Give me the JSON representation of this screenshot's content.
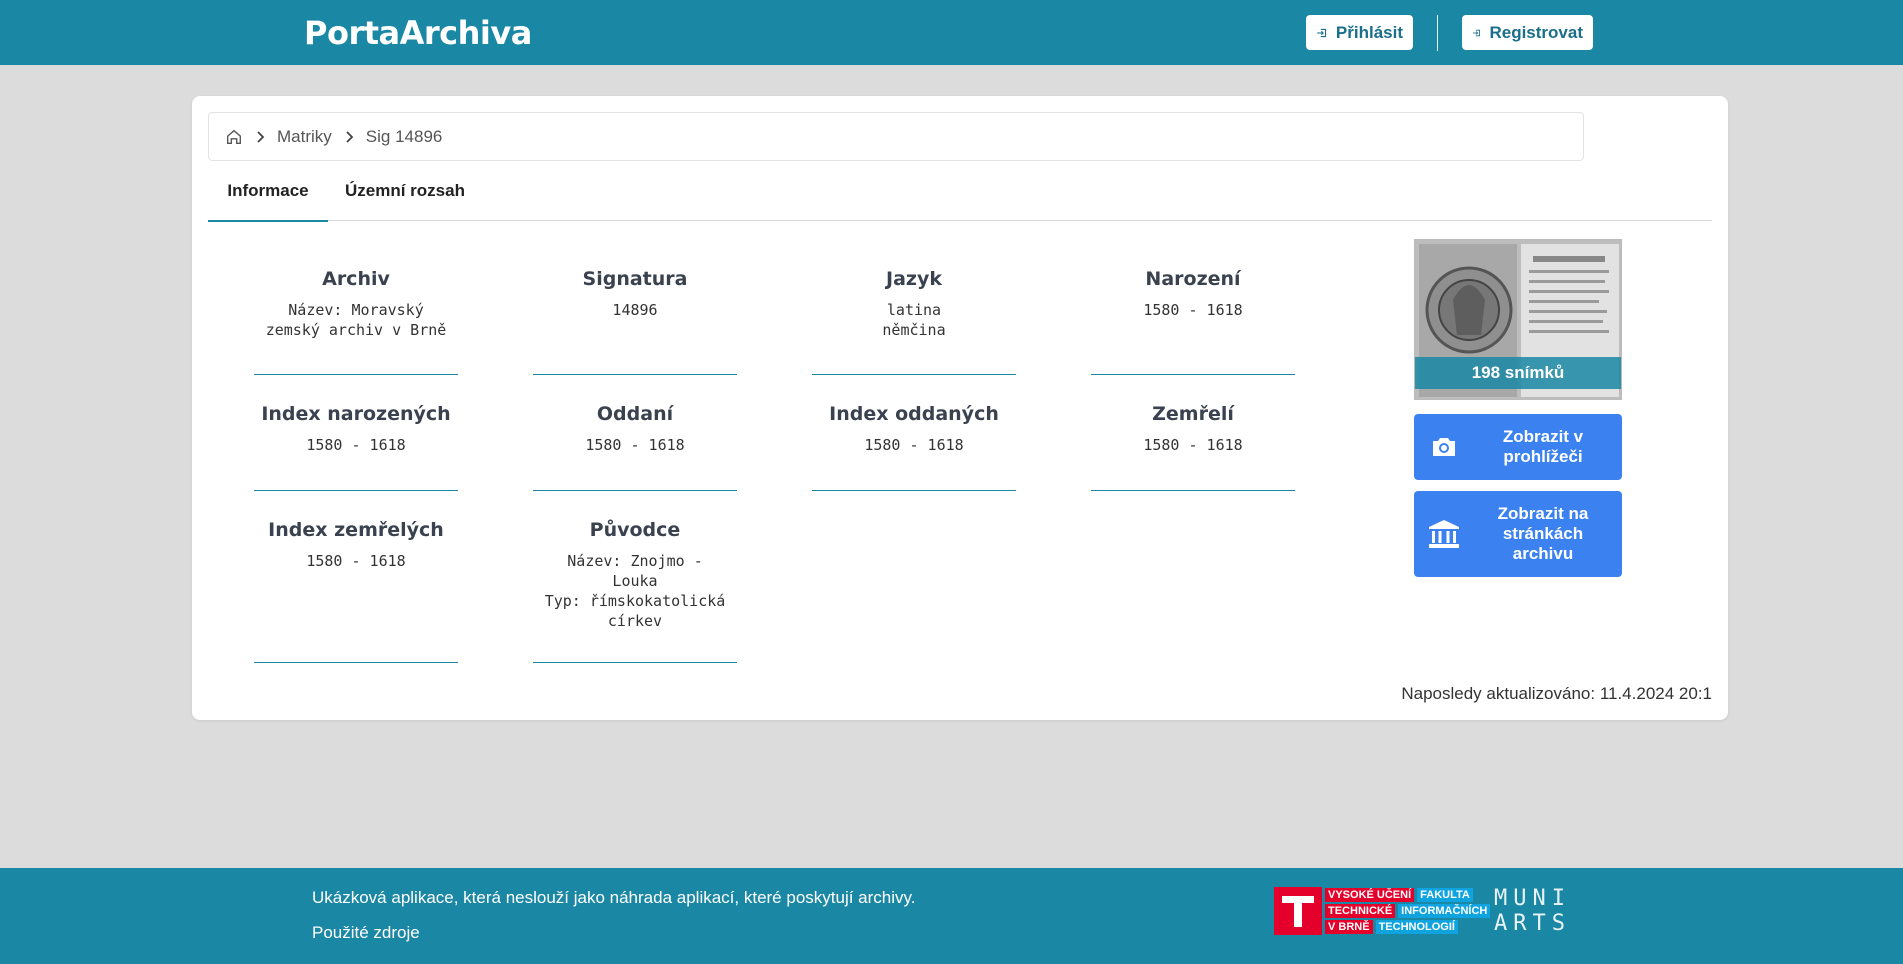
{
  "header": {
    "title": "PortaArchiva",
    "login_label": "Přihlásit",
    "register_label": "Registrovat"
  },
  "breadcrumb": {
    "items": [
      "Matriky",
      "Sig 14896"
    ]
  },
  "tabs": [
    {
      "label": "Informace",
      "active": true
    },
    {
      "label": "Územní rozsah",
      "active": false
    }
  ],
  "fields": [
    {
      "title": "Archiv",
      "value": "Název: Moravský\nzemský archiv v Brně"
    },
    {
      "title": "Signatura",
      "value": "14896"
    },
    {
      "title": "Jazyk",
      "value": "latina\nněmčina"
    },
    {
      "title": "Narození",
      "value": "1580 - 1618"
    },
    {
      "title": "Index narozených",
      "value": "1580 - 1618"
    },
    {
      "title": "Oddaní",
      "value": "1580 - 1618"
    },
    {
      "title": "Index oddaných",
      "value": "1580 - 1618"
    },
    {
      "title": "Zemřelí",
      "value": "1580 - 1618"
    },
    {
      "title": "Index zemřelých",
      "value": "1580 - 1618"
    },
    {
      "title": "Původce",
      "value": "Název: Znojmo -\nLouka\nTyp: římskokatolická\ncírkev"
    }
  ],
  "sidebar": {
    "scans_label": "198 snímků",
    "viewer_button": "Zobrazit v prohlížeči",
    "archive_button": "Zobrazit na stránkách archivu"
  },
  "updated": "Naposledy aktualizováno: 11.4.2024 20:1",
  "footer": {
    "note": "Ukázková aplikace, která neslouží jako náhrada aplikací, které poskytují archivy.",
    "sources_link": "Použité zdroje",
    "vut_logo": {
      "row1": [
        "VYSOKÉ UČENÍ",
        "FAKULTA"
      ],
      "row2": [
        "TECHNICKÉ",
        "INFORMAČNÍCH"
      ],
      "row3": [
        "V BRNĚ",
        "TECHNOLOGIÍ"
      ]
    },
    "muni_logo": {
      "line1": "MUNI",
      "line2": "ARTS"
    }
  },
  "colors": {
    "primary": "#1a87a5",
    "button_blue": "#3b82f0",
    "background": "#dcdcdc"
  },
  "icons": [
    "login-icon",
    "home-icon",
    "chevron-right-icon",
    "camera-icon",
    "bank-icon"
  ]
}
